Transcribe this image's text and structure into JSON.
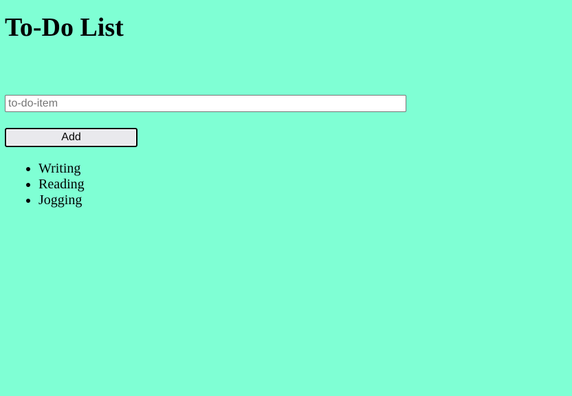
{
  "header": {
    "title": "To-Do List"
  },
  "form": {
    "input_placeholder": "to-do-item",
    "input_value": "",
    "add_label": "Add"
  },
  "todos": [
    {
      "label": "Writing"
    },
    {
      "label": "Reading"
    },
    {
      "label": "Jogging"
    }
  ],
  "colors": {
    "background": "#7fffd4"
  }
}
